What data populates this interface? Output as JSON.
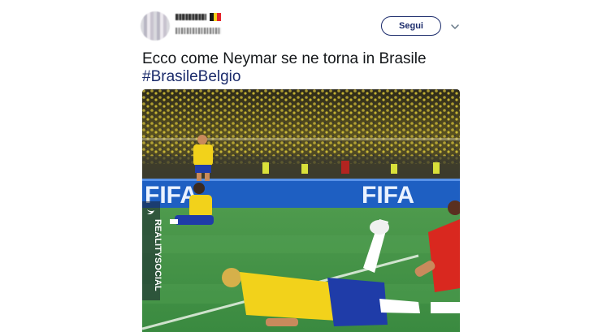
{
  "user": {
    "display_name": "",
    "flag": "Belgium flag",
    "handle": ""
  },
  "actions": {
    "follow_label": "Segui",
    "menu_icon": "chevron-down-icon"
  },
  "tweet": {
    "text": "Ecco come Neymar se ne torna in Brasile",
    "hashtag": "#BrasileBelgio"
  },
  "media": {
    "ad_board_left": "FIFA",
    "ad_board_right": "FIFA",
    "watermark": "REALITYSOCIAL",
    "watermark_icon": "twitter-bird-icon"
  },
  "colors": {
    "accent": "#1b2b6b",
    "pitch": "#3f8f46",
    "brazil_yellow": "#f2d21b",
    "brazil_blue": "#1f3ca8",
    "opponent_red": "#d9281f",
    "ad_board_blue": "#1e5fc2"
  }
}
